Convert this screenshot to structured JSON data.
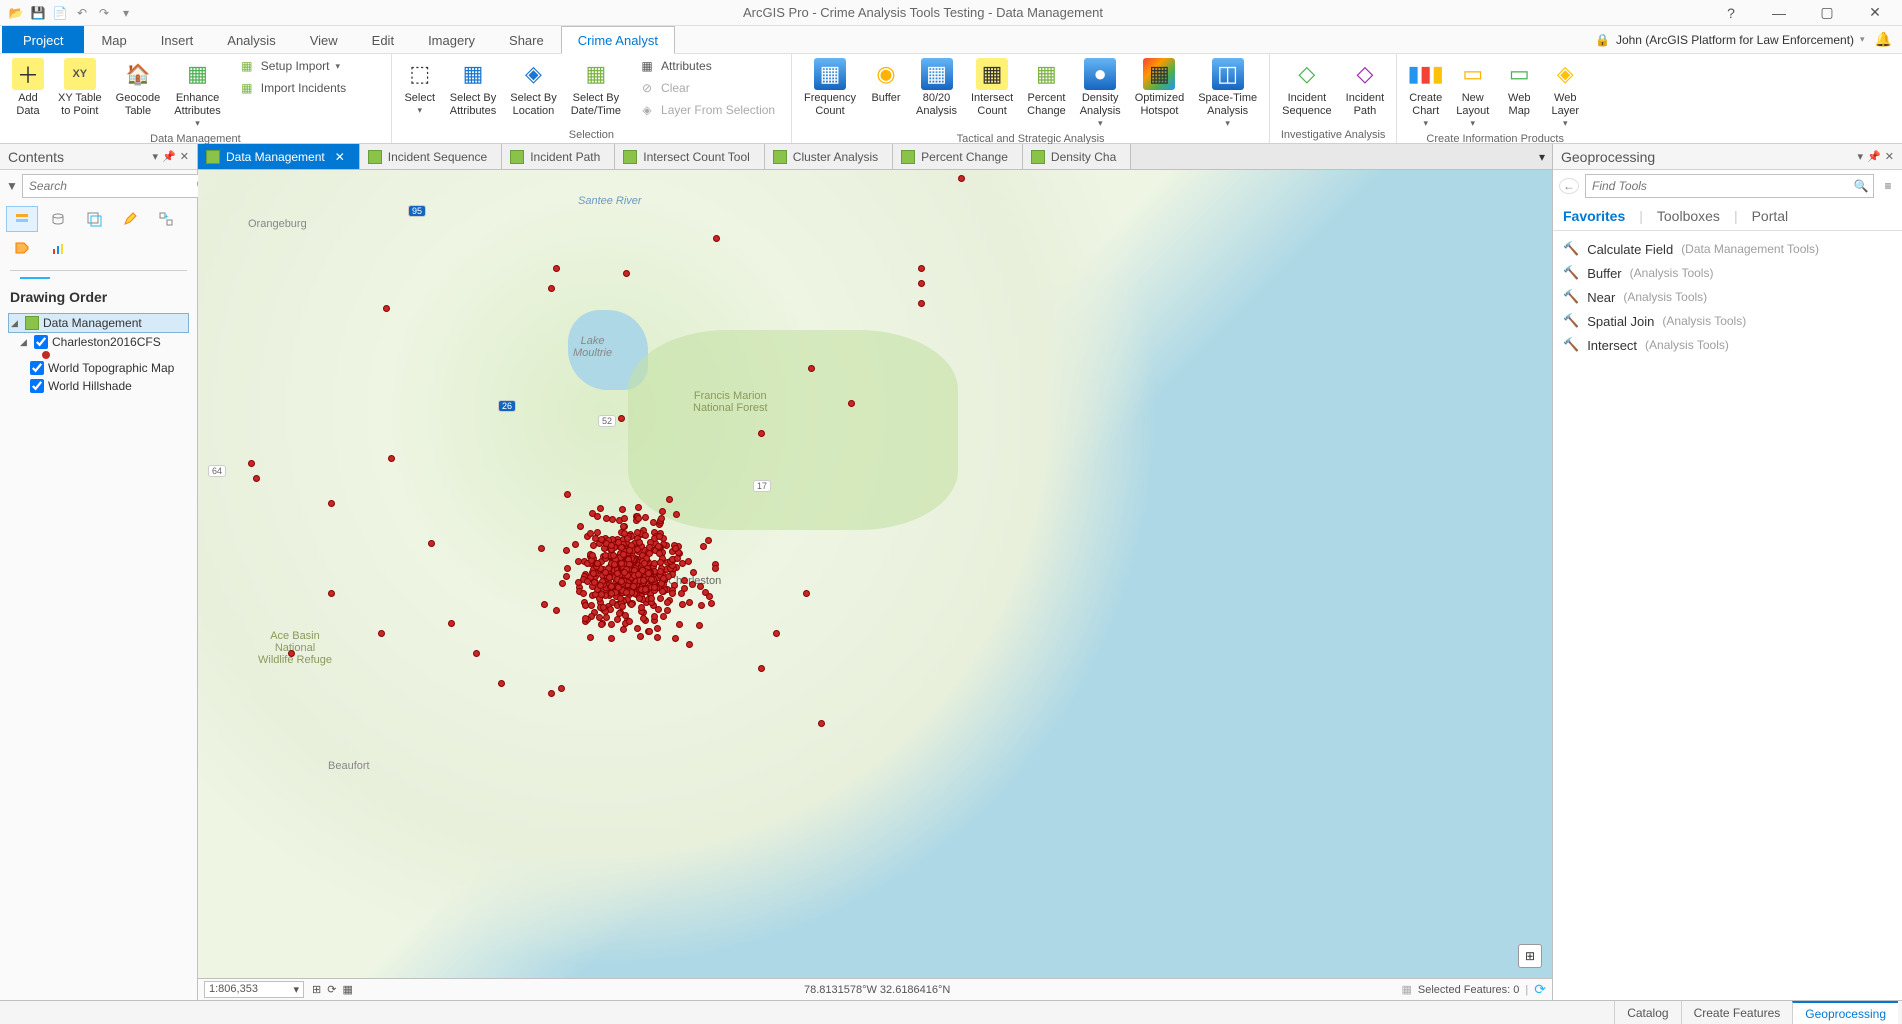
{
  "title": "ArcGIS Pro - Crime Analysis Tools Testing - Data Management",
  "user": {
    "name": "John (ArcGIS Platform for Law Enforcement)"
  },
  "ribbon_tabs": {
    "project": "Project",
    "list": [
      "Map",
      "Insert",
      "Analysis",
      "View",
      "Edit",
      "Imagery",
      "Share",
      "Crime Analyst"
    ],
    "active": "Crime Analyst"
  },
  "ribbon": {
    "g1": {
      "label": "Data Management",
      "add_data": "Add\nData",
      "xy_table": "XY Table\nto Point",
      "geocode_table": "Geocode\nTable",
      "enhance_attrs": "Enhance\nAttributes",
      "setup_import": "Setup Import",
      "import_incidents": "Import Incidents"
    },
    "g2": {
      "label": "Selection",
      "select": "Select",
      "sel_attrs": "Select By\nAttributes",
      "sel_loc": "Select By\nLocation",
      "sel_dt": "Select By\nDate/Time",
      "attributes": "Attributes",
      "clear": "Clear",
      "layer_from_sel": "Layer From Selection"
    },
    "g3": {
      "label": "Tactical and Strategic Analysis",
      "freq_count": "Frequency\nCount",
      "buffer": "Buffer",
      "8020": "80/20\nAnalysis",
      "intersect_count": "Intersect\nCount",
      "percent_change": "Percent\nChange",
      "density": "Density\nAnalysis",
      "opt_hotspot": "Optimized\nHotspot",
      "spacetime": "Space-Time\nAnalysis"
    },
    "g4": {
      "label": "Investigative Analysis",
      "incident_seq": "Incident\nSequence",
      "incident_path": "Incident\nPath"
    },
    "g5": {
      "label": "Create Information Products",
      "create_chart": "Create\nChart",
      "new_layout": "New\nLayout",
      "web_map": "Web\nMap",
      "web_layer": "Web\nLayer"
    }
  },
  "map_tabs": [
    "Data Management",
    "Incident Sequence",
    "Incident Path",
    "Intersect Count Tool",
    "Cluster Analysis",
    "Percent Change",
    "Density Cha"
  ],
  "contents": {
    "title": "Contents",
    "search_placeholder": "Search",
    "drawing_order": "Drawing Order",
    "root": "Data Management",
    "layers": [
      "Charleston2016CFS",
      "World Topographic Map",
      "World Hillshade"
    ]
  },
  "map": {
    "labels": {
      "orangeburg": "Orangeburg",
      "beaufort": "Beaufort",
      "lake": "Lake\nMoultrie",
      "santee": "Santee River",
      "fmf": "Francis Marion\nNational Forest",
      "ace": "Ace Basin\nNational\nWildlife Refuge",
      "charleston": "Charleston"
    },
    "roads": {
      "i95": "95",
      "i26": "26",
      "us64": "64",
      "us17": "17",
      "us52": "52"
    },
    "scale": "1:806,353",
    "coords": "78.8131578°W 32.6186416°N",
    "selected": "Selected Features: 0"
  },
  "geoprocessing": {
    "title": "Geoprocessing",
    "search_placeholder": "Find Tools",
    "tabs": [
      "Favorites",
      "Toolboxes",
      "Portal"
    ],
    "items": [
      {
        "name": "Calculate Field",
        "cat": "(Data Management Tools)"
      },
      {
        "name": "Buffer",
        "cat": "(Analysis Tools)"
      },
      {
        "name": "Near",
        "cat": "(Analysis Tools)"
      },
      {
        "name": "Spatial Join",
        "cat": "(Analysis Tools)"
      },
      {
        "name": "Intersect",
        "cat": "(Analysis Tools)"
      }
    ]
  },
  "footer_tabs": [
    "Catalog",
    "Create Features",
    "Geoprocessing"
  ]
}
